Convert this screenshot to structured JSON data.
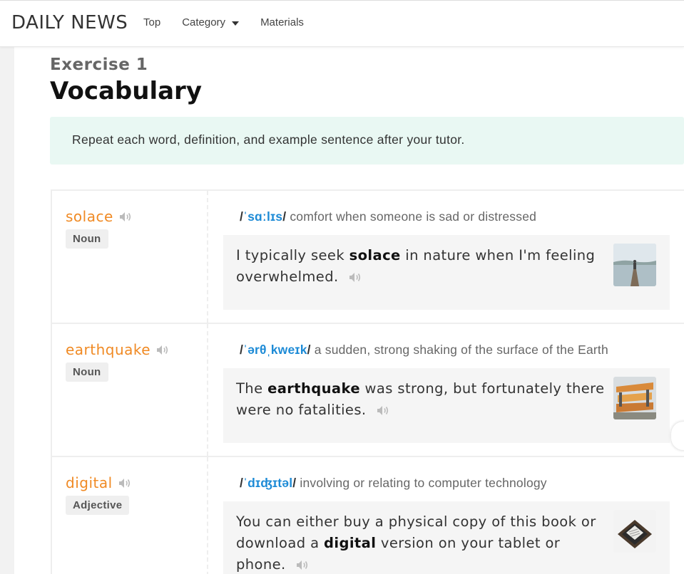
{
  "header": {
    "brand": "DAILY NEWS",
    "nav": [
      {
        "label": "Top"
      },
      {
        "label": "Category",
        "has_dropdown": true
      },
      {
        "label": "Materials"
      }
    ]
  },
  "exercise": {
    "label": "Exercise 1",
    "title": "Vocabulary",
    "instruction": "Repeat each word, definition, and example sentence after your tutor."
  },
  "vocab": [
    {
      "word": "solace",
      "pos": "Noun",
      "ipa": "ˈsɑːlɪs",
      "definition": "comfort when someone is sad or distressed",
      "example_parts": [
        "I typically seek ",
        "solace",
        " in nature when I'm feeling overwhelmed."
      ],
      "thumb": "lake-dock-icon"
    },
    {
      "word": "earthquake",
      "pos": "Noun",
      "ipa": "ˈərθˌkweɪk",
      "definition": "a sudden, strong shaking of the surface of the Earth",
      "example_parts": [
        "The ",
        "earthquake",
        " was strong, but fortunately there were no fatalities."
      ],
      "thumb": "damaged-building-icon"
    },
    {
      "word": "digital",
      "pos": "Adjective",
      "ipa": "ˈdɪʤɪtəl",
      "definition": "involving or relating to computer technology",
      "example_parts": [
        "You can either buy a physical copy of this book or download a ",
        "digital",
        " version on your tablet or phone."
      ],
      "thumb": "tablet-book-icon"
    }
  ],
  "colors": {
    "accent_orange": "#f08a24",
    "ipa_blue": "#1e8bd6",
    "instruction_bg": "#e9f8f3"
  }
}
